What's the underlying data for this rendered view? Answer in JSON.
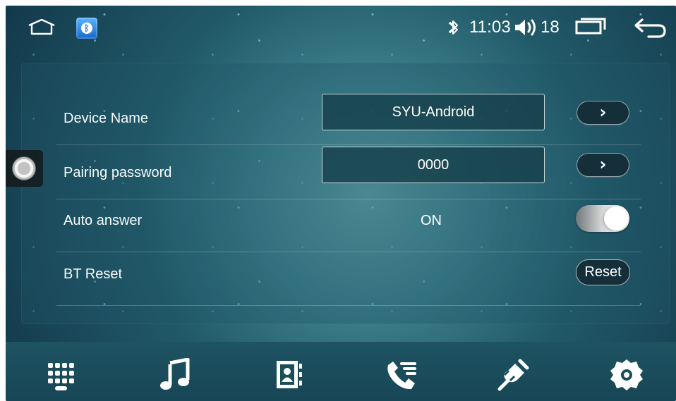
{
  "status_bar": {
    "time": "11:03",
    "volume_level": "18",
    "icons": {
      "home": "home-icon",
      "bluetooth_app": "bluetooth-app-icon",
      "bluetooth_status": "bluetooth-icon",
      "volume": "volume-icon",
      "recents": "recents-icon",
      "back": "back-icon"
    }
  },
  "settings": {
    "device_name": {
      "label": "Device Name",
      "value": "SYU-Android"
    },
    "pairing_password": {
      "label": "Pairing password",
      "value": "0000"
    },
    "auto_answer": {
      "label": "Auto answer",
      "value": "ON",
      "enabled": true
    },
    "bt_reset": {
      "label": "BT Reset",
      "button_label": "Reset"
    },
    "arrow_icon": "chevron-right-icon"
  },
  "bottom_nav": [
    {
      "name": "dialpad",
      "icon": "dialpad-icon"
    },
    {
      "name": "music",
      "icon": "music-note-icon"
    },
    {
      "name": "contacts",
      "icon": "contacts-icon"
    },
    {
      "name": "call-log",
      "icon": "call-log-icon"
    },
    {
      "name": "connection",
      "icon": "connection-plug-icon"
    },
    {
      "name": "settings",
      "icon": "gear-icon",
      "active": true
    }
  ],
  "colors": {
    "background_center": "#5fa2a8",
    "background_edge": "#12384a",
    "panel": "#205568",
    "button": "#142f3a",
    "text": "#ffffff"
  }
}
